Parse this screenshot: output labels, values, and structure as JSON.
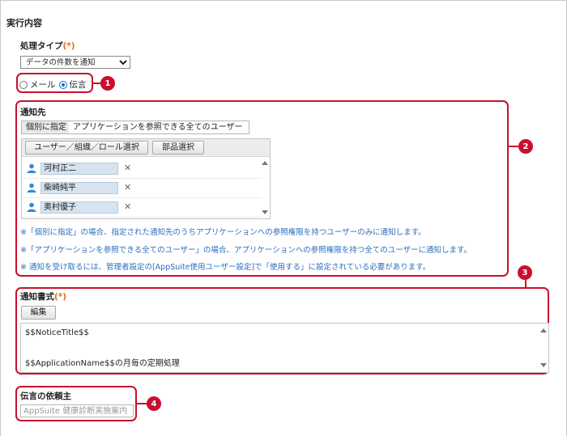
{
  "section_title": "実行内容",
  "process_type": {
    "label": "処理タイプ",
    "required_mark": "(*)",
    "selected": "データの件数を通知"
  },
  "method": {
    "options": [
      "メール",
      "伝言"
    ],
    "selected": "伝言"
  },
  "recipients": {
    "label": "通知先",
    "tabs": [
      "個別に指定",
      "アプリケーションを参照できる全てのユーザー"
    ],
    "active_tab": "個別に指定",
    "buttons": {
      "user_select": "ユーザー／組織／ロール選択",
      "part_select": "部品選択"
    },
    "users": [
      "河村正二",
      "柴崎純平",
      "奥村優子"
    ],
    "notes": [
      "※「個別に指定」の場合、指定された通知先のうちアプリケーションへの参照権限を持つユーザーのみに通知します。",
      "※「アプリケーションを参照できる全てのユーザー」の場合、アプリケーションへの参照権限を持つ全てのユーザーに通知します。",
      "※ 通知を受け取るには、管理者設定の[AppSuite使用ユーザー設定]で「使用する」に設定されている必要があります。"
    ]
  },
  "format": {
    "label": "通知書式",
    "required_mark": "(*)",
    "edit_button": "編集",
    "lines": [
      "$$NoticeTitle$$",
      "$$ApplicationName$$の月毎の定期処理"
    ]
  },
  "requester": {
    "label": "伝言の依頼主",
    "placeholder": "AppSuite 健康診断実施案内"
  },
  "callouts": [
    "1",
    "2",
    "3",
    "4"
  ],
  "colors": {
    "callout_red": "#c8102e",
    "required_orange": "#e07020",
    "note_blue": "#2a6ebb",
    "user_chip": "#d6e4f0"
  }
}
